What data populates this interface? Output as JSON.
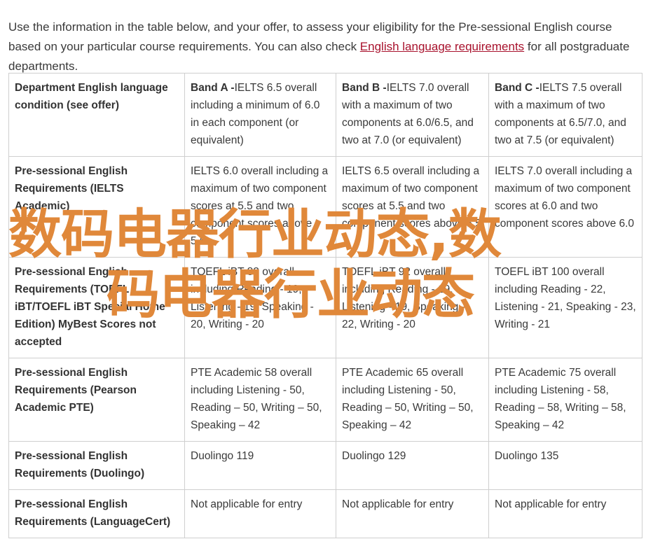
{
  "intro": {
    "text_before": "Use the information in the table below, and your offer, to assess your eligibility for the Pre-sessional English course based on your particular course requirements. You can also check ",
    "link": "English language requirements",
    "text_after": " for all postgraduate departments."
  },
  "table": {
    "header": {
      "col1": "Department English language condition (see offer)",
      "bands": [
        {
          "name": "Band A -",
          "text": "IELTS 6.5 overall including a minimum of 6.0 in each component (or equivalent)"
        },
        {
          "name": "Band B -",
          "text": "IELTS 7.0 overall with a maximum of two components at 6.0/6.5, and two at 7.0 (or equivalent)"
        },
        {
          "name": "Band C -",
          "text": "IELTS 7.5 overall with a maximum of two components at 6.5/7.0, and two at 7.5 (or equivalent)"
        }
      ]
    },
    "rows": [
      {
        "label": "Pre-sessional English Requirements (IELTS Academic)",
        "cells": [
          "IELTS 6.0 overall including a maximum of two component scores at 5.5 and two component scores above 5.5",
          "IELTS 6.5 overall including a maximum of two component scores at 5.5 and two component scores above 5.5",
          "IELTS 7.0 overall including a maximum of two component scores at 6.0 and two component scores above 6.0"
        ]
      },
      {
        "label": "Pre-sessional English Requirements (TOEFL iBT/TOEFL iBT Special Home Edition) MyBest Scores not accepted",
        "cells": [
          "TOEFL iBT 82 overall including Reading - 19, Listening - 19, Speaking - 20, Writing - 20",
          "TOEFL iBT 92 overall including Reading - 19, Listening - 19, Speaking - 22, Writing - 20",
          "TOEFL iBT 100 overall including Reading - 22, Listening - 21, Speaking - 23, Writing - 21"
        ]
      },
      {
        "label": "Pre-sessional English Requirements (Pearson Academic PTE)",
        "cells": [
          "PTE Academic 58 overall including Listening - 50, Reading – 50, Writing – 50, Speaking – 42",
          "PTE Academic 65 overall including Listening - 50, Reading – 50, Writing – 50, Speaking – 42",
          "PTE Academic 75 overall including Listening - 58, Reading – 58, Writing – 58, Speaking – 42"
        ]
      },
      {
        "label": "Pre-sessional English Requirements (Duolingo)",
        "cells": [
          "Duolingo 119",
          "Duolingo 129",
          "Duolingo 135"
        ]
      },
      {
        "label": "Pre-sessional English Requirements (LanguageCert)",
        "cells": [
          "Not applicable for entry",
          "Not applicable for entry",
          "Not applicable for entry"
        ]
      }
    ]
  },
  "watermark": {
    "line1": "数码电器行业动态,数",
    "line2": "码电器行业动态",
    "color": "#e0883a"
  }
}
